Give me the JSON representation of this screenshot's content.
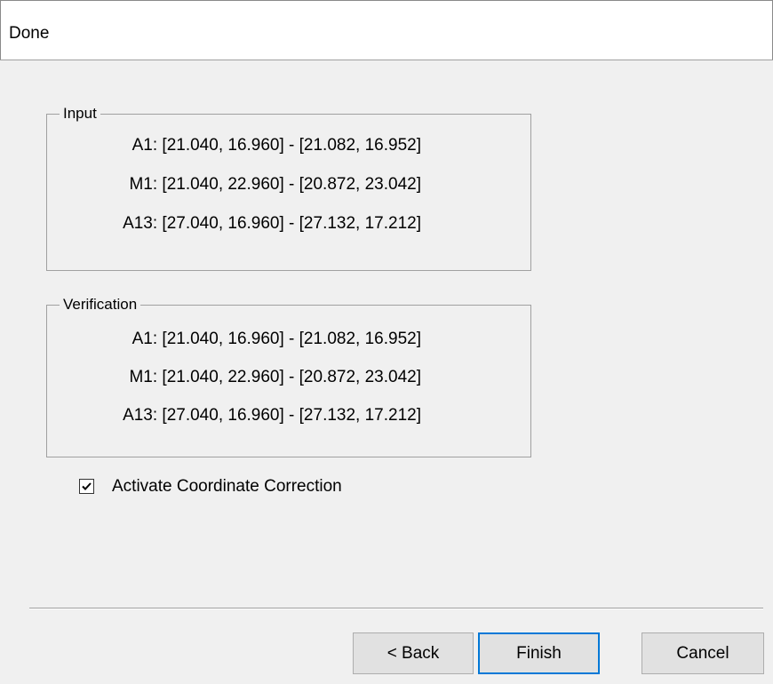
{
  "header": {
    "title": "Done"
  },
  "input_group": {
    "label": "Input",
    "lines": [
      "A1: [21.040, 16.960] - [21.082, 16.952]",
      "M1: [21.040, 22.960] - [20.872, 23.042]",
      "A13: [27.040, 16.960] - [27.132, 17.212]"
    ]
  },
  "verification_group": {
    "label": "Verification",
    "lines": [
      "A1: [21.040, 16.960] - [21.082, 16.952]",
      "M1: [21.040, 22.960] - [20.872, 23.042]",
      "A13: [27.040, 16.960] - [27.132, 17.212]"
    ]
  },
  "checkbox": {
    "label": "Activate Coordinate Correction",
    "checked": true
  },
  "buttons": {
    "back": "< Back",
    "finish": "Finish",
    "cancel": "Cancel"
  }
}
